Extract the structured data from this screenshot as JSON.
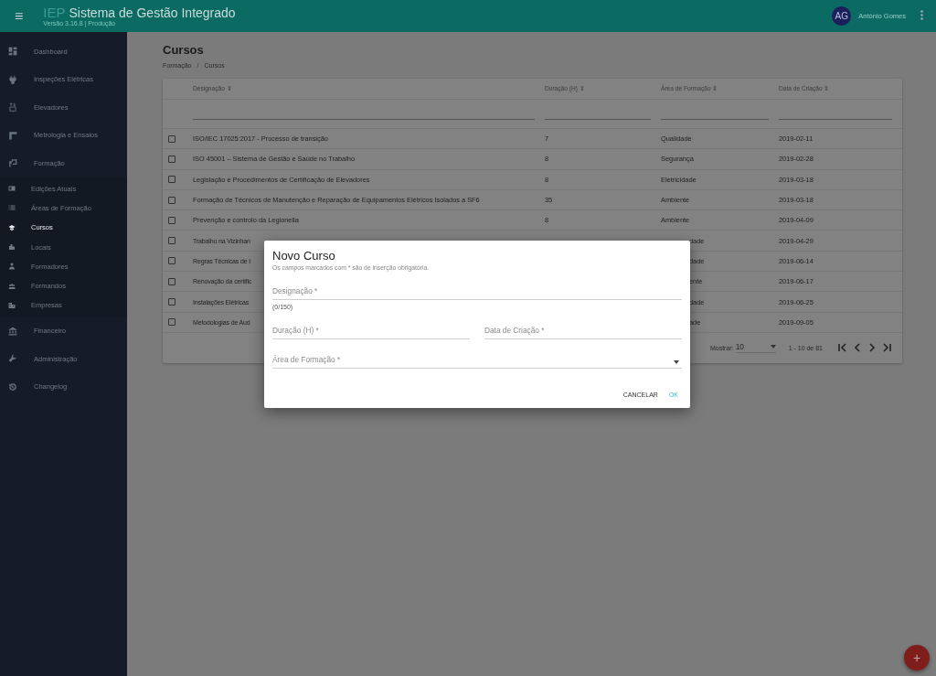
{
  "header": {
    "menu_icon": "≡",
    "brand": "IEP",
    "title": "Sistema de Gestão Integrado",
    "version": "Versão 3.16.8 | Produção",
    "user": {
      "initials": "AG",
      "name": "António Gomes"
    }
  },
  "sidebar": {
    "items": [
      {
        "label": "Dashboard",
        "selected": false
      },
      {
        "label": "Inspeções Elétricas",
        "selected": false
      },
      {
        "label": "Elevadores",
        "selected": false
      },
      {
        "label": "Metrologia e Ensaios",
        "selected": false
      },
      {
        "label": "Formação",
        "selected": false,
        "expanded": true,
        "children": [
          {
            "label": "Edições Atuais",
            "selected": false
          },
          {
            "label": "Áreas de Formação",
            "selected": false
          },
          {
            "label": "Cursos",
            "selected": true
          },
          {
            "label": "Locais",
            "selected": false
          },
          {
            "label": "Formadores",
            "selected": false
          },
          {
            "label": "Formandos",
            "selected": false
          },
          {
            "label": "Empresas",
            "selected": false
          }
        ]
      },
      {
        "label": "Financeiro",
        "selected": false
      },
      {
        "label": "Administração",
        "selected": false
      },
      {
        "label": "Changelog",
        "selected": false
      }
    ]
  },
  "page": {
    "title": "Cursos",
    "breadcrumb": [
      "Formação",
      "Cursos"
    ],
    "breadcrumb_separator": "/"
  },
  "table": {
    "columns": [
      {
        "label": "Designação",
        "sort_icon": "⇕"
      },
      {
        "label": "Duração (H)",
        "sort_icon": "⇕"
      },
      {
        "label": "Área de Formação",
        "sort_icon": "⇕"
      },
      {
        "label": "Data de Criação",
        "sort_icon": "⇕"
      }
    ],
    "rows": [
      {
        "checked": false,
        "designation": "ISO/IEC 17025:2017 - Processo de transição",
        "duration": "7",
        "area": "Qualidade",
        "date": "2019-02-11"
      },
      {
        "checked": false,
        "designation": "ISO 45001 – Sistema de Gestão e Saúde no Trabalho",
        "duration": "8",
        "area": "Segurança",
        "date": "2019-02-28"
      },
      {
        "checked": false,
        "designation": "Legislação e Procedimentos de Certificação de Elevadores",
        "duration": "8",
        "area": "Eletricidade",
        "date": "2019-03-18"
      },
      {
        "checked": false,
        "designation": "Formação de Técnicos de Manutenção e Reparação de Equipamentos Elétricos Isolados a SF6",
        "duration": "35",
        "area": "Ambiente",
        "date": "2019-03-18"
      },
      {
        "checked": false,
        "designation": "Prevenção e controlo da Legionella",
        "duration": "8",
        "area": "Ambiente",
        "date": "2019-04-09"
      },
      {
        "checked": false,
        "designation": "Trabalho na Vizinhan",
        "area": "dade",
        "covered": true,
        "date": "2019-04-29"
      },
      {
        "checked": false,
        "designation": "Regras Técnicas de I",
        "area": "dade",
        "covered": true,
        "date": "2019-06-14"
      },
      {
        "checked": false,
        "designation": "Renovação da certific",
        "area": "ente",
        "covered": true,
        "date": "2019-06-17"
      },
      {
        "checked": false,
        "designation": "Instalações Elétricas",
        "area": "dade",
        "covered": true,
        "date": "2019-06-25"
      },
      {
        "checked": false,
        "designation": "Metodologias de Aud",
        "area": "ade",
        "covered": true,
        "date": "2019-09-05"
      }
    ]
  },
  "pagination": {
    "label": "Mostrar:",
    "page_size": "10",
    "range": "1 - 10 de 81"
  },
  "dialog": {
    "title": "Novo Curso",
    "subtitle": "Os campos marcados com * são de inserção obrigatória.",
    "field_rows": [
      [
        {
          "kind": "text",
          "label": "Designação *",
          "counter": "(0/150)"
        }
      ],
      [
        {
          "kind": "text",
          "label": "Duração (H) *"
        },
        {
          "kind": "text",
          "label": "Data de Criação *"
        }
      ],
      [
        {
          "kind": "select",
          "label": "Área de Formação *"
        }
      ]
    ],
    "buttons": [
      {
        "label": "CANCELAR",
        "primary": false
      },
      {
        "label": "OK",
        "primary": true
      }
    ]
  },
  "fab": {
    "label": "+"
  }
}
